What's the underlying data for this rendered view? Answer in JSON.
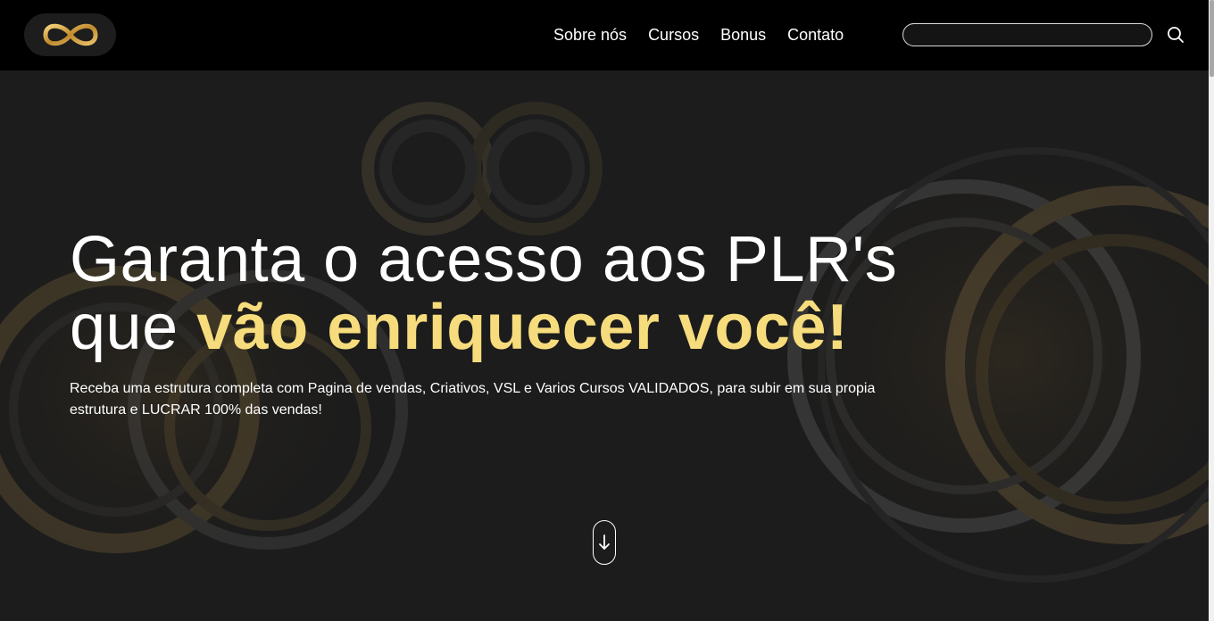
{
  "header": {
    "logo_icon": "infinity-icon",
    "nav": [
      {
        "label": "Sobre nós"
      },
      {
        "label": "Cursos"
      },
      {
        "label": "Bonus"
      },
      {
        "label": "Contato"
      }
    ],
    "search": {
      "placeholder": "",
      "value": "",
      "icon": "search-icon"
    }
  },
  "hero": {
    "title_line1": "Garanta o acesso aos PLR's",
    "title_line2_plain": "que ",
    "title_line2_accent": "vão enriquecer você!",
    "subtitle": "Receba uma estrutura completa com Pagina de vendas, Criativos, VSL e Varios Cursos VALIDADOS, para subir em sua propia estrutura e LUCRAR 100% das vendas!",
    "scroll_icon": "arrow-down-icon"
  },
  "colors": {
    "navbar_bg": "#000000",
    "hero_bg": "#1c1c1c",
    "accent_gold": "#f6dc7c",
    "logo_gold": "#c9973a",
    "text": "#ffffff"
  }
}
